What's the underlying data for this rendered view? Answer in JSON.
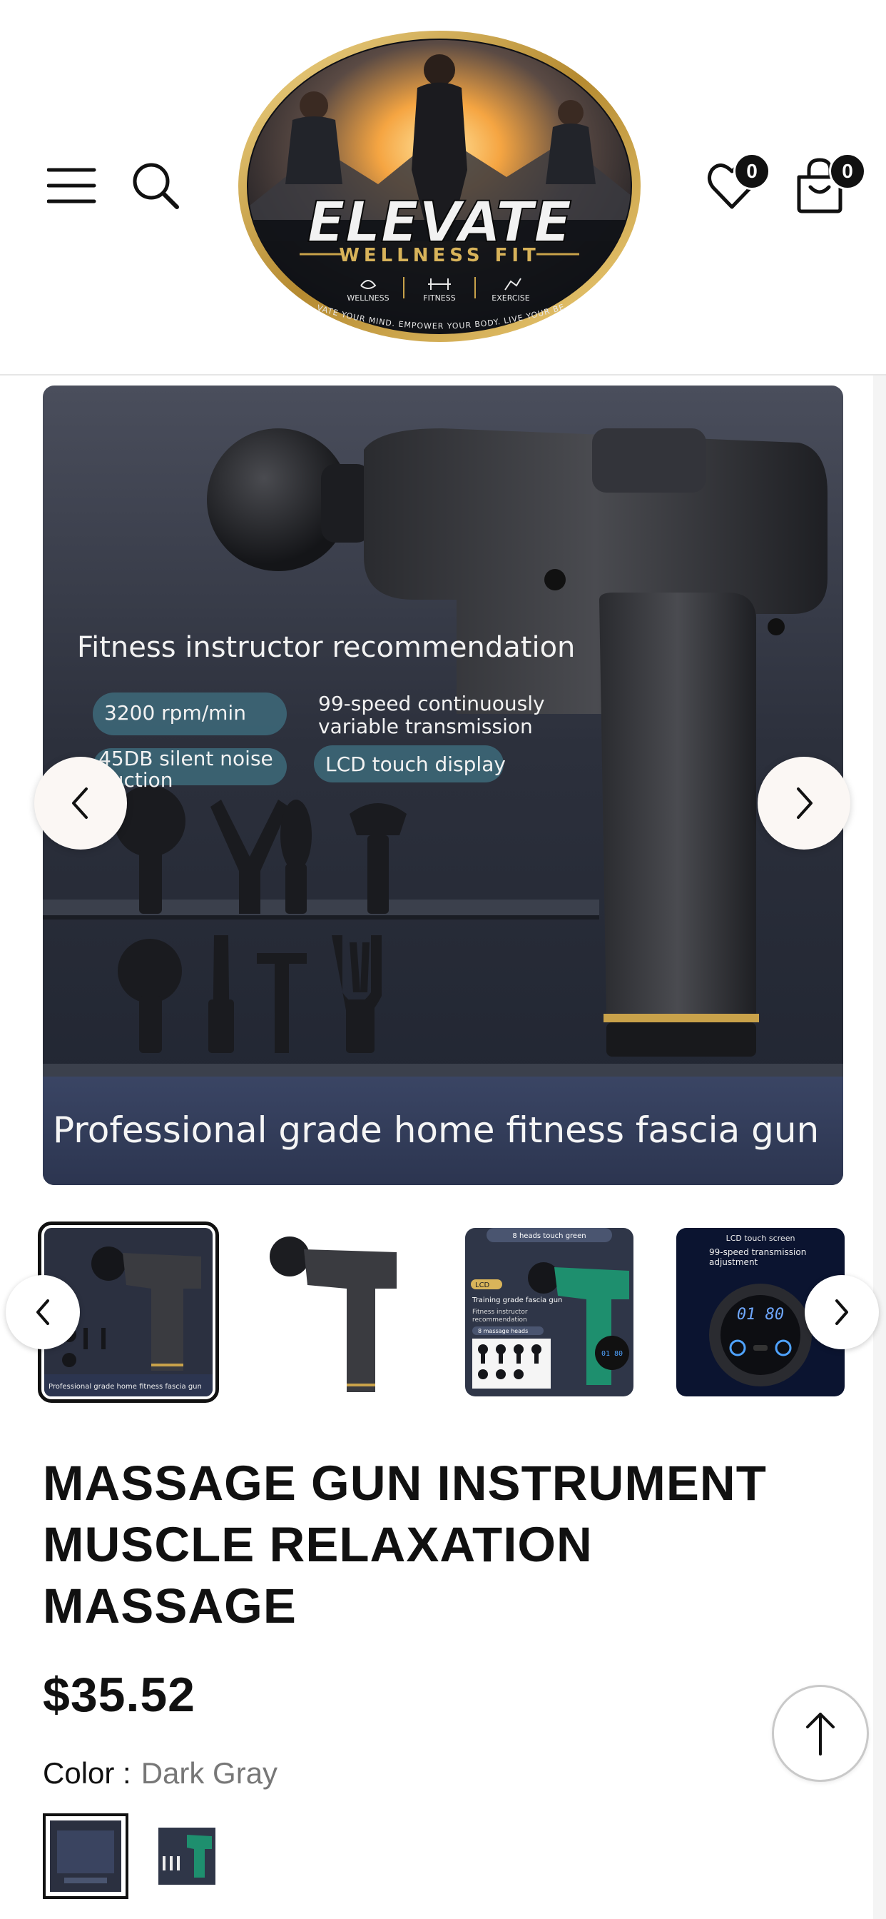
{
  "header": {
    "logo": {
      "brand": "ELEVATE",
      "sub": "WELLNESS FIT",
      "tags": [
        "WELLNESS",
        "FITNESS",
        "EXERCISE"
      ],
      "tagline": "ELEVATE YOUR MIND. EMPOWER YOUR BODY. LIVE YOUR BEST."
    },
    "wishlist_count": "0",
    "cart_count": "0"
  },
  "gallery": {
    "main_image": {
      "headline": "Fitness instructor recommendation",
      "features": [
        "3200 rpm/min",
        "99-speed continuously",
        "variable transmission",
        "45DB silent noise",
        "duction",
        "LCD touch display"
      ],
      "caption": "Professional grade home fitness fascia gun"
    },
    "thumbnails": [
      {
        "caption": "Professional grade home fitness fascia gun"
      },
      {
        "caption": ""
      },
      {
        "top": "8 heads touch green",
        "lcd": "LCD",
        "line1": "Training grade fascia gun",
        "line2": "Fitness instructor",
        "line3": "recommendation",
        "heads": "8 massage heads",
        "display": "01 80"
      },
      {
        "top": "LCD touch screen",
        "line1": "99-speed transmission",
        "line2": "adjustment",
        "display": "01 80"
      }
    ]
  },
  "product": {
    "title": "MASSAGE GUN INSTRUMENT MUSCLE RELAXATION MASSAGE",
    "price": "$35.52",
    "color_label": "Color :",
    "color_value": "Dark Gray"
  },
  "colors": {
    "text": "#111111",
    "muted": "#777777",
    "image_bg": "#2b3040"
  }
}
